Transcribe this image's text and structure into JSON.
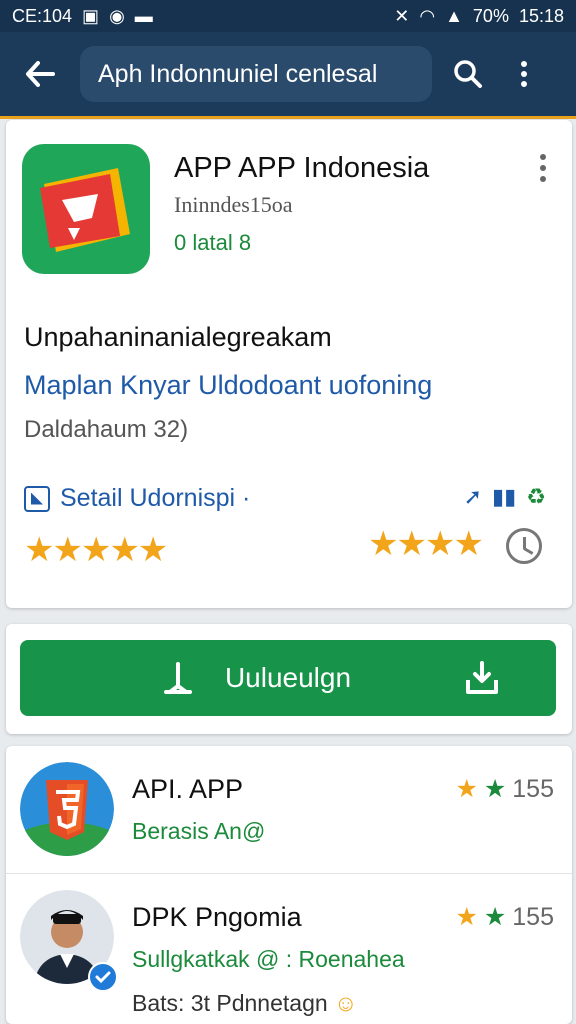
{
  "status_bar": {
    "left_text": "CE:104",
    "right_text": "15:18",
    "battery": "70%"
  },
  "header": {
    "search_text": "Aph Indonnuniel cenlesal"
  },
  "app": {
    "title": "APP APP Indonesia",
    "developer": "Ininndes15oa",
    "install_status": "0 latal 8",
    "description_title": "Unpahaninanialegreakam",
    "description_link": "Maplan Knyar Uldodoant uofoning",
    "description_sub": "Daldahaum 32)",
    "detail_label": "Setail Udornispi ·"
  },
  "install_button": {
    "label": "Uulueulgn"
  },
  "related": [
    {
      "title": "API. APP",
      "subtitle": "Berasis An@",
      "rating": "155",
      "icon": "html5-shield-icon"
    },
    {
      "title": "DPK Pngomia",
      "subtitle": "Sullgkatkak @ : Roenahea",
      "extra": "Bats: 3t Pdnnetagn",
      "rating": "155",
      "icon": "person-avatar"
    }
  ],
  "colors": {
    "primary": "#1c3a5a",
    "accent": "#e8a21c",
    "green": "#18944a",
    "link": "#1f5aa8",
    "star": "#f2a51a"
  }
}
